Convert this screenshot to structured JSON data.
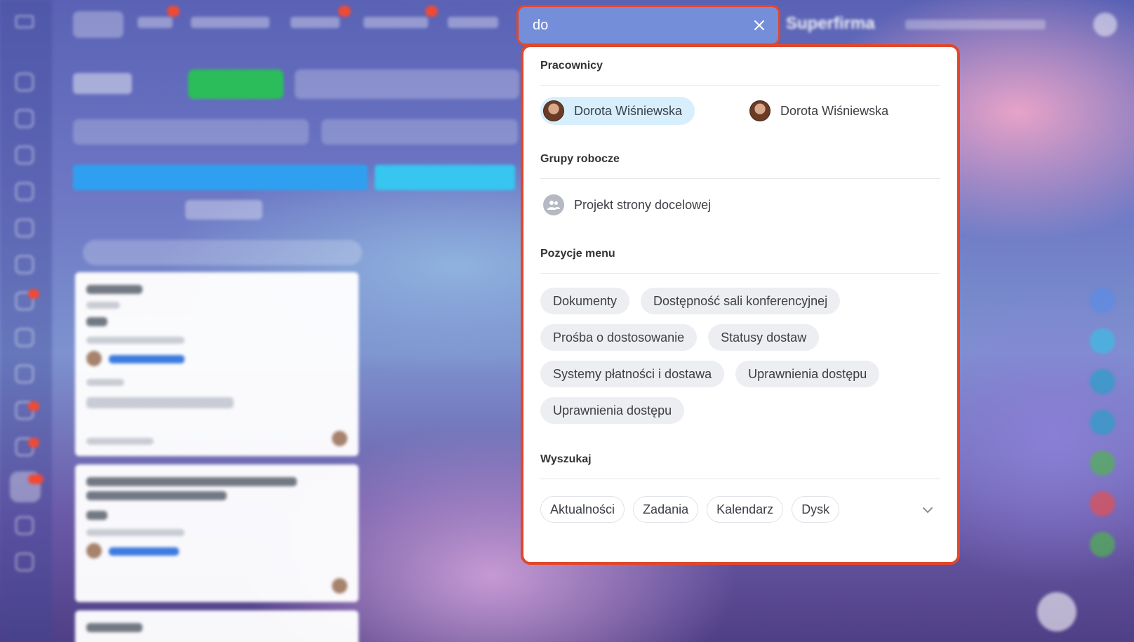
{
  "brand": "Superfirma",
  "search": {
    "query": "do",
    "clear_label": "Wyczyść"
  },
  "results": {
    "employees": {
      "title": "Pracownicy",
      "items": [
        {
          "name": "Dorota Wiśniewska",
          "selected": true
        },
        {
          "name": "Dorota Wiśniewska",
          "selected": false
        }
      ]
    },
    "workgroups": {
      "title": "Grupy robocze",
      "items": [
        {
          "name": "Projekt strony docelowej",
          "icon": "group-icon"
        }
      ]
    },
    "menu_items": {
      "title": "Pozycje menu",
      "items": [
        "Dokumenty",
        "Dostępność sali konferencyjnej",
        "Prośba o dostosowanie",
        "Statusy dostaw",
        "Systemy płatności i dostawa",
        "Uprawnienia dostępu",
        "Uprawnienia dostępu"
      ]
    },
    "search_in": {
      "title": "Wyszukaj",
      "scopes": [
        "Aktualności",
        "Zadania",
        "Kalendarz",
        "Dysk"
      ],
      "more_icon": "chevron-down-icon"
    }
  },
  "colors": {
    "highlight_border": "#e2472a",
    "selected_person_bg": "#d7effc",
    "chip_bg": "#eceef1"
  }
}
